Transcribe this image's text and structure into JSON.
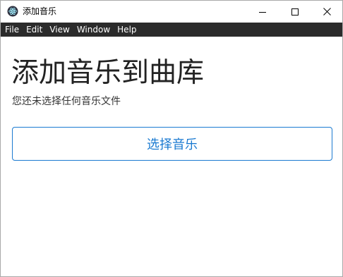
{
  "window": {
    "title": "添加音乐",
    "app_icon": "electron-icon",
    "controls": {
      "minimize_icon": "minimize-icon",
      "maximize_icon": "maximize-icon",
      "close_icon": "close-icon"
    }
  },
  "menubar": {
    "items": [
      {
        "label": "File"
      },
      {
        "label": "Edit"
      },
      {
        "label": "View"
      },
      {
        "label": "Window"
      },
      {
        "label": "Help"
      }
    ]
  },
  "main": {
    "heading": "添加音乐到曲库",
    "subtext": "您还未选择任何音乐文件",
    "select_button_label": "选择音乐"
  },
  "colors": {
    "menubar_bg": "#2b2b2b",
    "accent": "#1a7ad1"
  }
}
